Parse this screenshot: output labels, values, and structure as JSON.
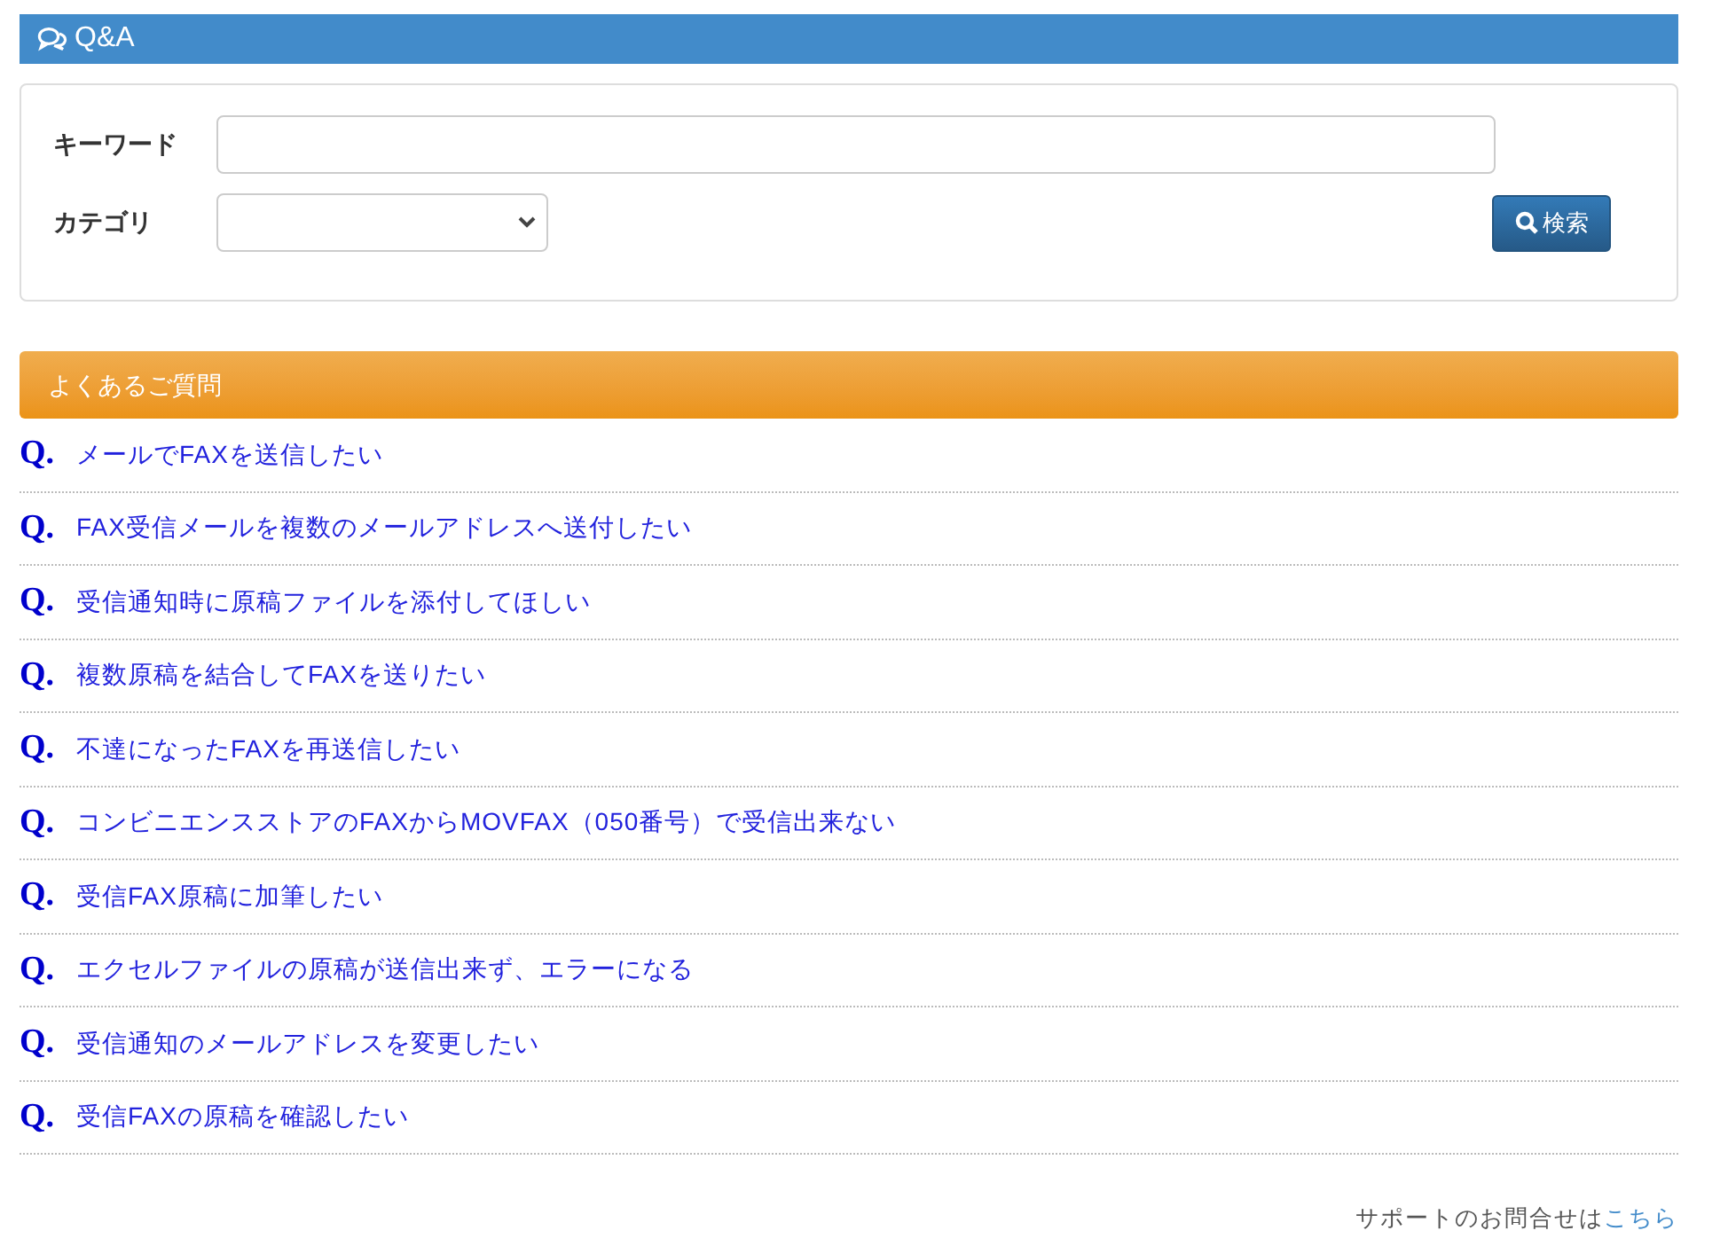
{
  "header": {
    "title": "Q&A"
  },
  "search_form": {
    "keyword_label": "キーワード",
    "category_label": "カテゴリ",
    "search_button": "検索"
  },
  "faq": {
    "title": "よくあるご質問",
    "items": [
      {
        "marker": "Q.",
        "question": "メールでFAXを送信したい"
      },
      {
        "marker": "Q.",
        "question": "FAX受信メールを複数のメールアドレスへ送付したい"
      },
      {
        "marker": "Q.",
        "question": "受信通知時に原稿ファイルを添付してほしい"
      },
      {
        "marker": "Q.",
        "question": "複数原稿を結合してFAXを送りたい"
      },
      {
        "marker": "Q.",
        "question": "不達になったFAXを再送信したい"
      },
      {
        "marker": "Q.",
        "question": "コンビニエンスストアのFAXからMOVFAX（050番号）で受信出来ない"
      },
      {
        "marker": "Q.",
        "question": "受信FAX原稿に加筆したい"
      },
      {
        "marker": "Q.",
        "question": "エクセルファイルの原稿が送信出来ず、エラーになる"
      },
      {
        "marker": "Q.",
        "question": "受信通知のメールアドレスを変更したい"
      },
      {
        "marker": "Q.",
        "question": "受信FAXの原稿を確認したい"
      }
    ]
  },
  "footer": {
    "text": "サポートのお問合せは",
    "link": "こちら"
  }
}
